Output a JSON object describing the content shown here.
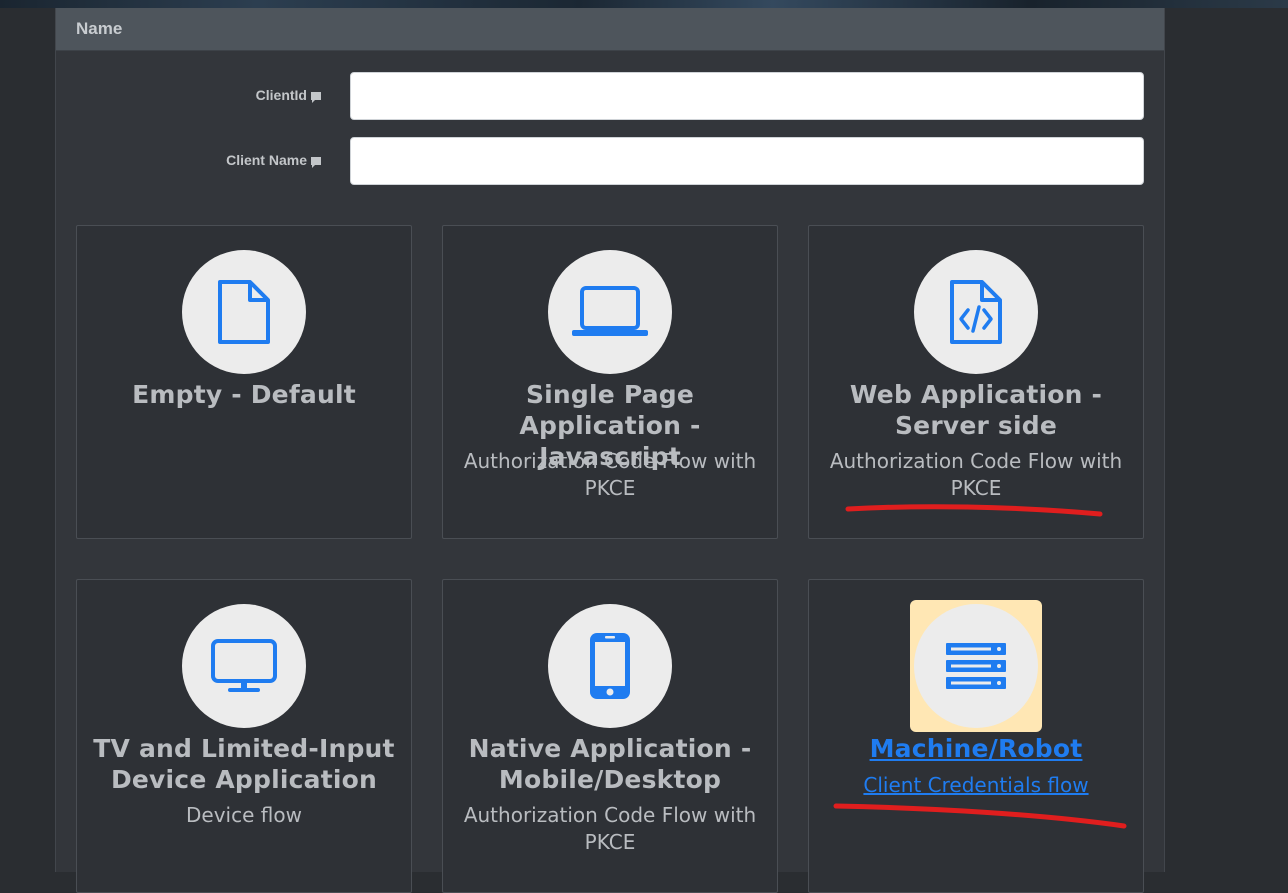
{
  "panel": {
    "header_label": "Name"
  },
  "form": {
    "client_id": {
      "label": "ClientId",
      "value": ""
    },
    "client_name": {
      "label": "Client Name",
      "value": ""
    }
  },
  "cards": [
    {
      "title": "Empty - Default",
      "subtitle": "",
      "icon": "file-icon"
    },
    {
      "title": "Single Page Application - Javascript",
      "subtitle": "Authorization Code Flow with PKCE",
      "icon": "laptop-icon"
    },
    {
      "title": "Web Application - Server side",
      "subtitle": "Authorization Code Flow with PKCE",
      "icon": "file-code-icon"
    },
    {
      "title": "TV and Limited-Input Device Application",
      "subtitle": "Device flow",
      "icon": "tv-icon"
    },
    {
      "title": "Native Application - Mobile/Desktop",
      "subtitle": "Authorization Code Flow with PKCE",
      "icon": "phone-icon"
    },
    {
      "title": "Machine/Robot",
      "subtitle": "Client Credentials flow",
      "icon": "server-icon",
      "selected": true
    }
  ],
  "colors": {
    "accent": "#1f7cf0",
    "highlight": "#ffe7b4",
    "annotation": "#e01e1e"
  }
}
